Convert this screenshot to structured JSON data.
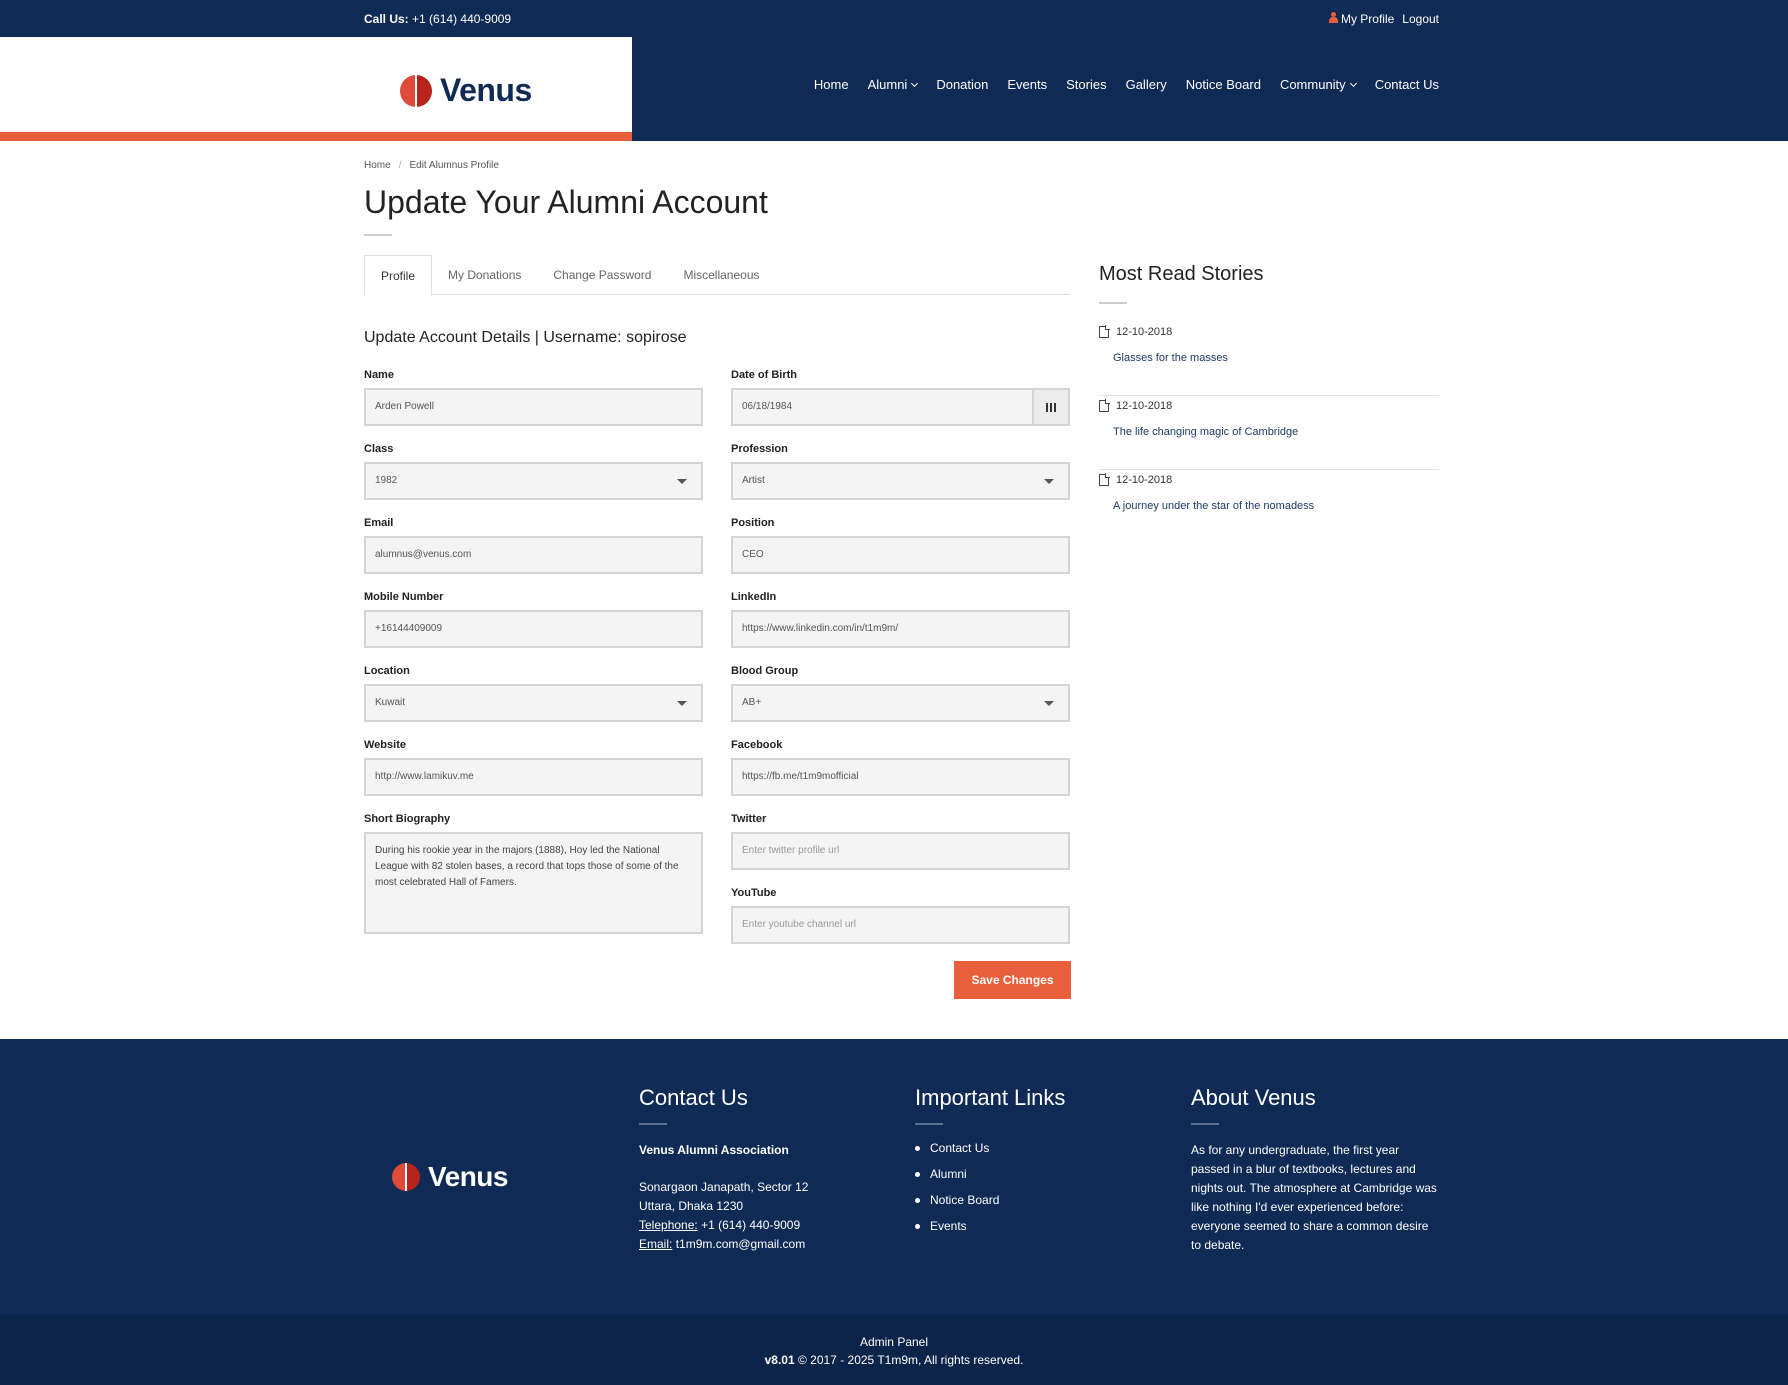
{
  "topbar": {
    "call_label": "Call Us:",
    "phone": "+1 (614) 440-9009",
    "my_profile": "My Profile",
    "logout": "Logout"
  },
  "brand": {
    "name": "Venus"
  },
  "nav": {
    "home": "Home",
    "alumni": "Alumni",
    "donation": "Donation",
    "events": "Events",
    "stories": "Stories",
    "gallery": "Gallery",
    "notice_board": "Notice Board",
    "community": "Community",
    "contact_us": "Contact Us"
  },
  "breadcrumb": {
    "home": "Home",
    "sep": "/",
    "current": "Edit Alumnus Profile"
  },
  "page": {
    "title": "Update Your Alumni Account"
  },
  "tabs": {
    "profile": "Profile",
    "donations": "My Donations",
    "password": "Change Password",
    "misc": "Miscellaneous"
  },
  "form": {
    "section_title": "Update Account Details | Username: sopirose",
    "name": {
      "label": "Name",
      "value": "Arden Powell"
    },
    "dob": {
      "label": "Date of Birth",
      "value": "06/18/1984"
    },
    "class": {
      "label": "Class",
      "value": "1982"
    },
    "profession": {
      "label": "Profession",
      "value": "Artist"
    },
    "email": {
      "label": "Email",
      "value": "alumnus@venus.com"
    },
    "position": {
      "label": "Position",
      "value": "CEO"
    },
    "mobile": {
      "label": "Mobile Number",
      "value": "+16144409009"
    },
    "linkedin": {
      "label": "LinkedIn",
      "value": "https://www.linkedin.com/in/t1m9m/"
    },
    "location": {
      "label": "Location",
      "value": "Kuwait"
    },
    "blood_group": {
      "label": "Blood Group",
      "value": "AB+"
    },
    "website": {
      "label": "Website",
      "value": "http://www.lamikuv.me"
    },
    "facebook": {
      "label": "Facebook",
      "value": "https://fb.me/t1m9mofficial"
    },
    "bio": {
      "label": "Short Biography",
      "value": "During his rookie year in the majors (1888), Hoy led the National League with 82 stolen bases, a record that tops those of some of the most celebrated Hall of Famers."
    },
    "twitter": {
      "label": "Twitter",
      "placeholder": "Enter twitter profile url"
    },
    "youtube": {
      "label": "YouTube",
      "placeholder": "Enter youtube channel url"
    },
    "save_label": "Save Changes"
  },
  "sidebar": {
    "title": "Most Read Stories",
    "stories": [
      {
        "date": "12-10-2018",
        "title": "Glasses for the masses"
      },
      {
        "date": "12-10-2018",
        "title": "The life changing magic of Cambridge"
      },
      {
        "date": "12-10-2018",
        "title": "A journey under the star of the nomadess"
      }
    ]
  },
  "footer": {
    "contact": {
      "heading": "Contact Us",
      "org": "Venus Alumni Association",
      "address1": "Sonargaon Janapath, Sector 12",
      "address2": "Uttara, Dhaka 1230",
      "tel_label": "Telephone:",
      "tel": "+1 (614) 440-9009",
      "email_label": "Email:",
      "email": "t1m9m.com@gmail.com"
    },
    "links": {
      "heading": "Important Links",
      "items": [
        "Contact Us",
        "Alumni",
        "Notice Board",
        "Events"
      ]
    },
    "about": {
      "heading": "About Venus",
      "text": "As for any undergraduate, the first year passed in a blur of textbooks, lectures and nights out. The atmosphere at Cambridge was like nothing I'd ever experienced before: everyone seemed to share a common desire to debate."
    },
    "admin_panel": "Admin Panel",
    "version": "v8.01",
    "copyright": "© 2017 - 2025 T1m9m, All rights reserved."
  },
  "colors": {
    "navy": "#0f2a55",
    "accent": "#e85f3b"
  }
}
